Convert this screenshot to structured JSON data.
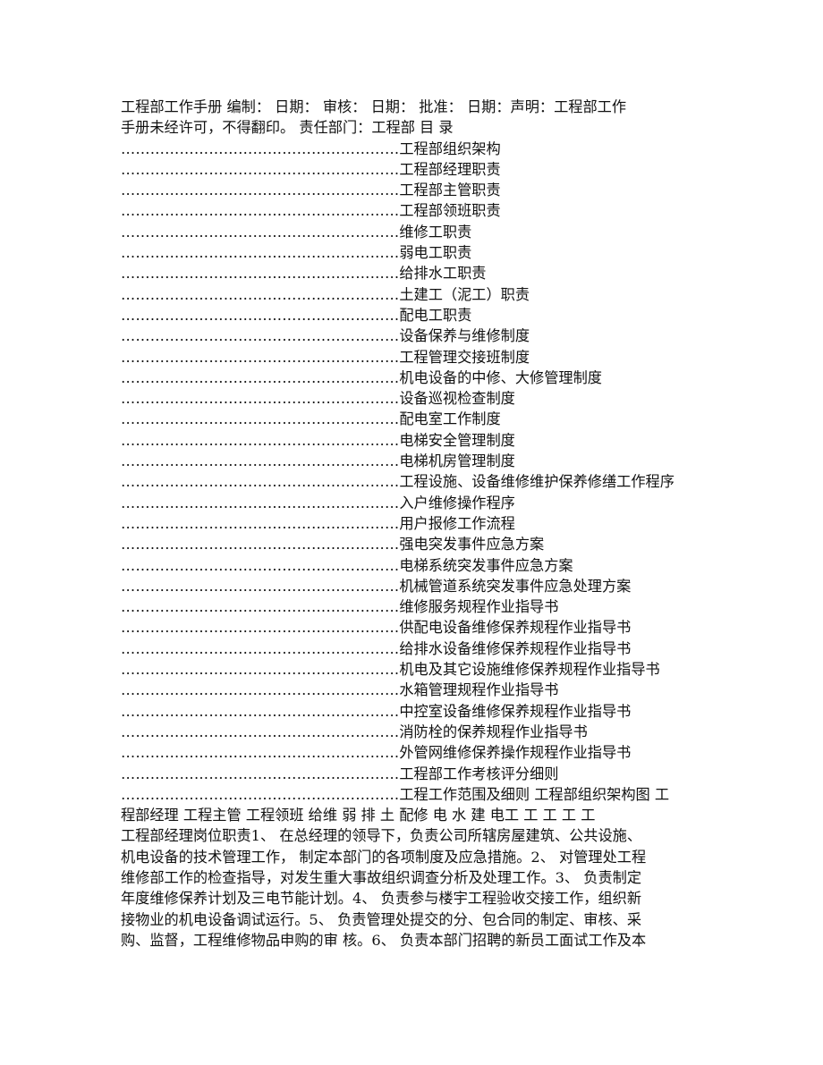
{
  "header": {
    "line1": "工程部工作手册  编制：  日期：  审核：  日期：  批准：  日期：声明：工程部工作",
    "line2": "手册未经许可，不得翻印。  责任部门：工程部  目  录"
  },
  "toc": {
    "leader": "…………………………………………………",
    "items": [
      "工程部组织架构",
      "工程部经理职责",
      "工程部主管职责",
      "工程部领班职责",
      "维修工职责",
      "弱电工职责",
      "给排水工职责",
      "土建工（泥工）职责",
      "配电工职责",
      "设备保养与维修制度",
      "工程管理交接班制度",
      "机电设备的中修、大修管理制度",
      "设备巡视检查制度",
      "配电室工作制度",
      "电梯安全管理制度",
      "电梯机房管理制度",
      "工程设施、设备维修维护保养修缮工作程序",
      "入户维修操作程序",
      "用户报修工作流程",
      "强电突发事件应急方案",
      "电梯系统突发事件应急方案",
      "机械管道系统突发事件应急处理方案",
      "维修服务规程作业指导书",
      "供配电设备维修保养规程作业指导书",
      "给排水设备维修保养规程作业指导书",
      "机电及其它设施维修保养规程作业指导书",
      "水箱管理规程作业指导书",
      "中控室设备维修保养规程作业指导书",
      "消防栓的保养规程作业指导书",
      "外管网维修保养操作规程作业指导书",
      "工程部工作考核评分细则",
      "工程工作范围及细则  工程部组织架构图  工"
    ]
  },
  "body": {
    "lines": [
      "程部经理  工程主管  工程领班  给维  弱  排  土  配修  电  水  建  电工  工  工  工  工",
      "工程部经理岗位职责1、  在总经理的领导下，负责公司所辖房屋建筑、公共设施、",
      "机电设备的技术管理工作，  制定本部门的各项制度及应急措施。2、  对管理处工程",
      "维修部工作的检查指导，对发生重大事故组织调查分析及处理工作。3、  负责制定",
      "年度维修保养计划及三电节能计划。4、  负责参与楼宇工程验收交接工作，组织新",
      "接物业的机电设备调试运行。5、  负责管理处提交的分、包合同的制定、审核、采",
      "购、监督，工程维修物品申购的审  核。6、  负责本部门招聘的新员工面试工作及本"
    ]
  }
}
